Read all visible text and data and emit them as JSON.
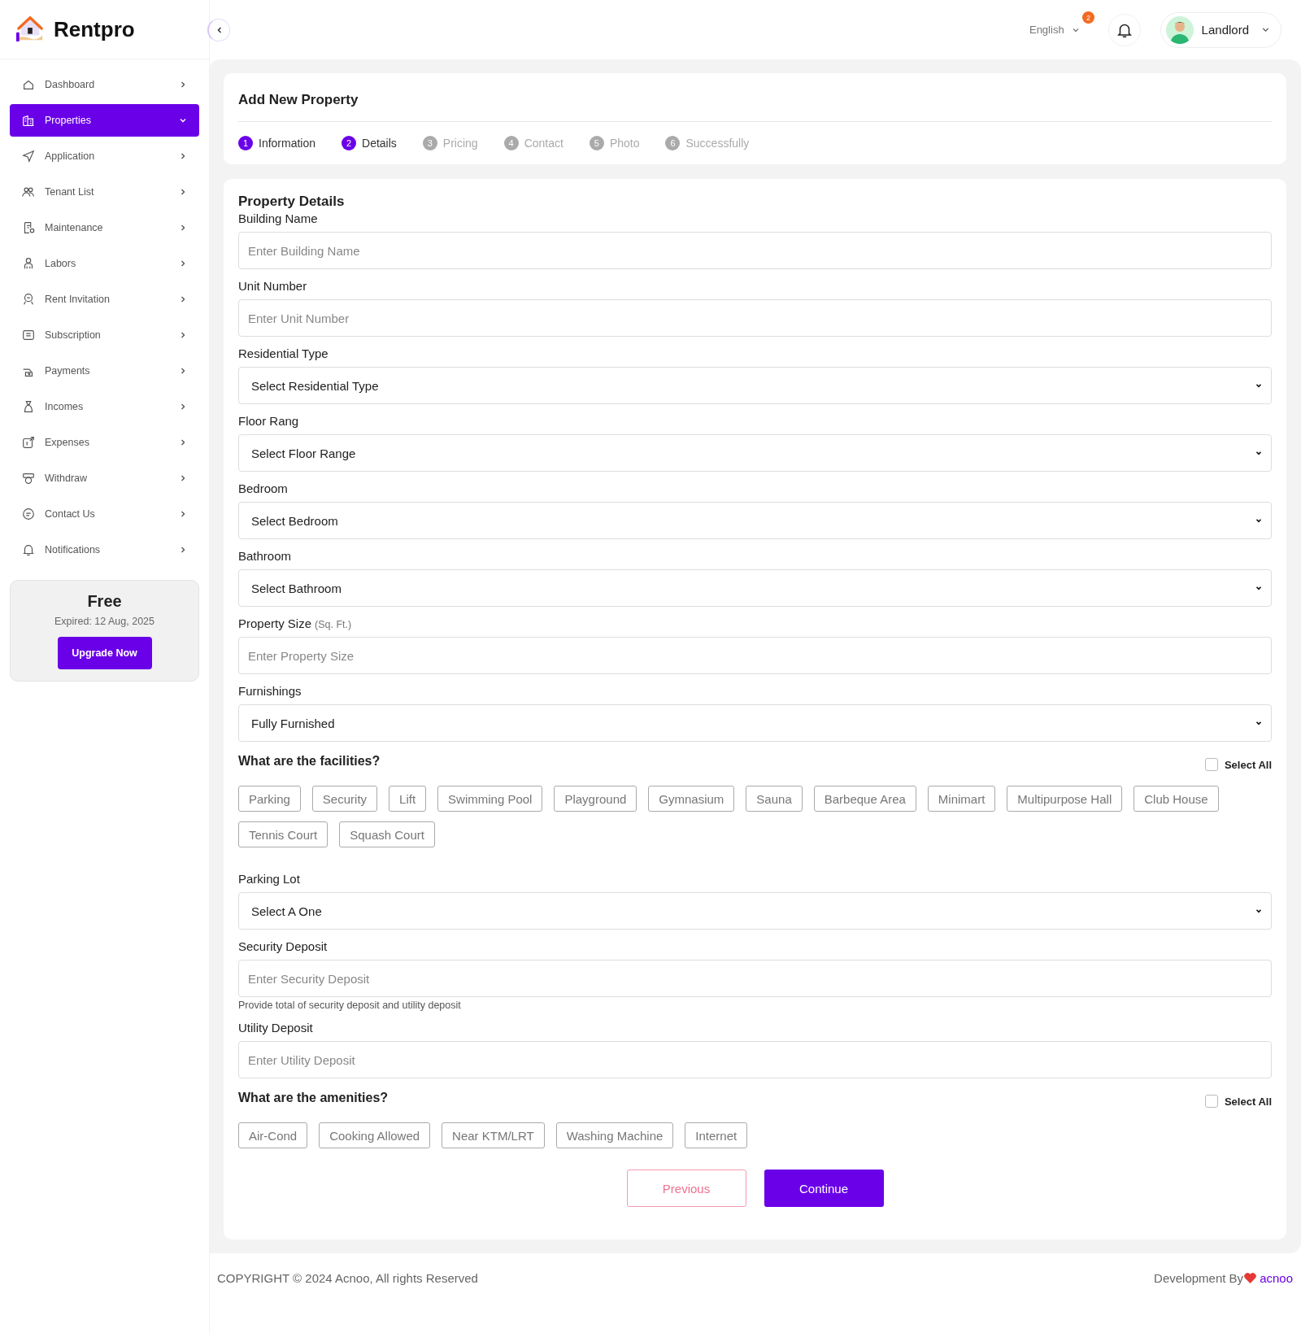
{
  "brand": {
    "name": "Rentpro"
  },
  "header": {
    "language": "English",
    "notification_count": "2",
    "user": "Landlord"
  },
  "sidebar": {
    "items": [
      {
        "label": "Dashboard",
        "selected": false,
        "expanded": false
      },
      {
        "label": "Properties",
        "selected": true,
        "expanded": true
      },
      {
        "label": "Application",
        "selected": false,
        "expanded": false
      },
      {
        "label": "Tenant List",
        "selected": false,
        "expanded": false
      },
      {
        "label": "Maintenance",
        "selected": false,
        "expanded": false
      },
      {
        "label": "Labors",
        "selected": false,
        "expanded": false
      },
      {
        "label": "Rent Invitation",
        "selected": false,
        "expanded": false
      },
      {
        "label": "Subscription",
        "selected": false,
        "expanded": false
      },
      {
        "label": "Payments",
        "selected": false,
        "expanded": false
      },
      {
        "label": "Incomes",
        "selected": false,
        "expanded": false
      },
      {
        "label": "Expenses",
        "selected": false,
        "expanded": false
      },
      {
        "label": "Withdraw",
        "selected": false,
        "expanded": false
      },
      {
        "label": "Contact Us",
        "selected": false,
        "expanded": false
      },
      {
        "label": "Notifications",
        "selected": false,
        "expanded": false
      }
    ],
    "plan": {
      "name": "Free",
      "expiry": "Expired: 12 Aug, 2025",
      "button": "Upgrade Now"
    }
  },
  "page": {
    "title": "Add New Property",
    "steps": [
      {
        "number": "1",
        "label": "Information",
        "active": true
      },
      {
        "number": "2",
        "label": "Details",
        "active": true
      },
      {
        "number": "3",
        "label": "Pricing",
        "active": false
      },
      {
        "number": "4",
        "label": "Contact",
        "active": false
      },
      {
        "number": "5",
        "label": "Photo",
        "active": false
      },
      {
        "number": "6",
        "label": "Successfully",
        "active": false
      }
    ]
  },
  "form": {
    "title": "Property Details",
    "sections": [
      {
        "kind": "input",
        "label": "Building Name",
        "placeholder": "Enter Building Name"
      },
      {
        "kind": "input",
        "label": "Unit Number",
        "placeholder": "Enter Unit Number"
      },
      {
        "kind": "select",
        "label": "Residential Type",
        "value": "Select Residential Type"
      },
      {
        "kind": "select",
        "label": "Floor Rang",
        "value": "Select Floor Range"
      },
      {
        "kind": "select",
        "label": "Bedroom",
        "value": "Select Bedroom"
      },
      {
        "kind": "select",
        "label": "Bathroom",
        "value": "Select Bathroom"
      },
      {
        "kind": "input",
        "label": "Property Size",
        "note": "(Sq. Ft.)",
        "placeholder": "Enter Property Size"
      },
      {
        "kind": "select",
        "label": "Furnishings",
        "value": "Fully Furnished"
      },
      {
        "kind": "chips",
        "title": "What are the facilities?",
        "select_all": {
          "label": "Select All",
          "checked": false
        },
        "options": [
          "Parking",
          "Security",
          "Lift",
          "Swimming Pool",
          "Playground",
          "Gymnasium",
          "Sauna",
          "Barbeque Area",
          "Minimart",
          "Multipurpose Hall",
          "Club House",
          "Tennis Court",
          "Squash Court"
        ]
      },
      {
        "kind": "select",
        "label": "Parking Lot",
        "value": "Select A One"
      },
      {
        "kind": "input",
        "label": "Security Deposit",
        "placeholder": "Enter Security Deposit",
        "hint": "Provide total of security deposit and utility deposit"
      },
      {
        "kind": "input",
        "label": "Utility Deposit",
        "placeholder": "Enter Utility Deposit"
      },
      {
        "kind": "chips",
        "title": "What are the amenities?",
        "select_all": {
          "label": "Select All",
          "checked": false
        },
        "options": [
          "Air-Cond",
          "Cooking Allowed",
          "Near KTM/LRT",
          "Washing Machine",
          "Internet"
        ]
      }
    ],
    "buttons": {
      "previous": "Previous",
      "continue": "Continue"
    }
  },
  "footer": {
    "copyright": "COPYRIGHT © 2024 Acnoo, All rights Reserved",
    "credit": "Development By",
    "credit_link": "acnoo"
  }
}
